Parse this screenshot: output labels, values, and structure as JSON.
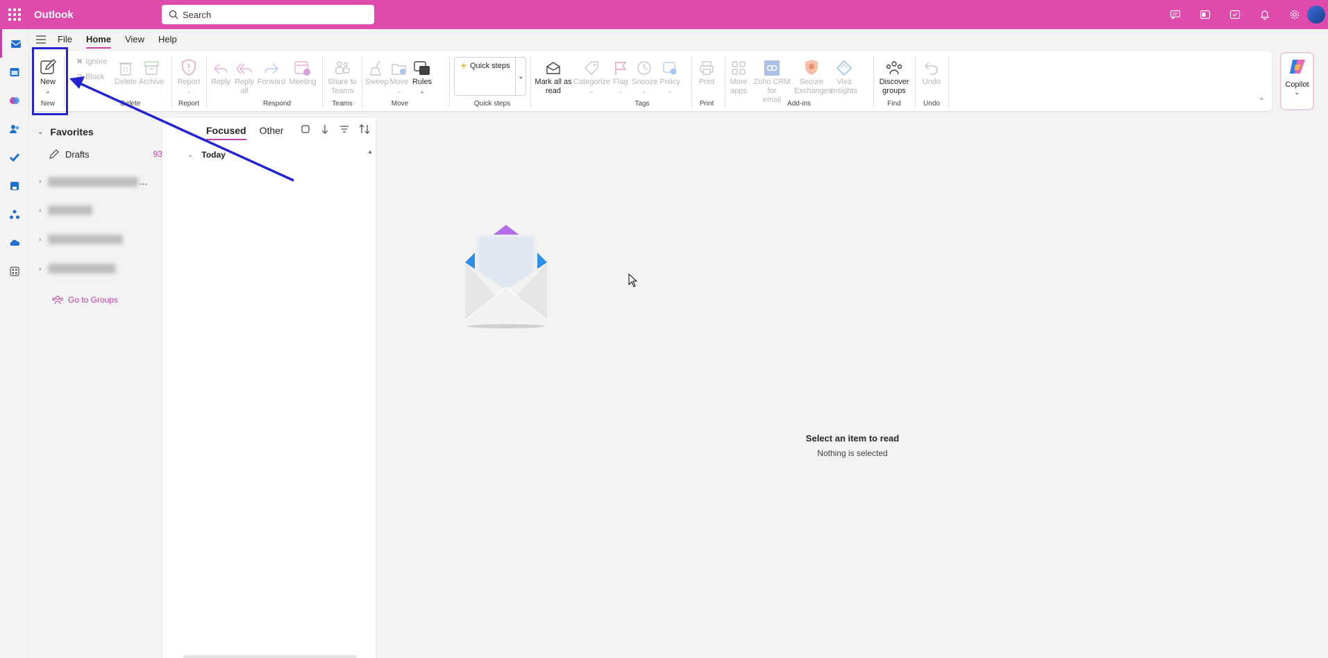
{
  "app": {
    "title": "Outlook",
    "accent": "#df4aad"
  },
  "search": {
    "placeholder": "Search"
  },
  "menu": {
    "tabs": [
      "File",
      "Home",
      "View",
      "Help"
    ],
    "active_tab": "Home"
  },
  "ribbon": {
    "new": {
      "label": "New",
      "group": "New"
    },
    "delete_group": {
      "ignore": "Ignore",
      "block": "Block",
      "delete": "Delete",
      "archive": "Archive",
      "group": "Delete"
    },
    "report": {
      "label": "Report",
      "group": "Report"
    },
    "respond": {
      "reply": "Reply",
      "reply_all_line1": "Reply",
      "reply_all_line2": "all",
      "forward": "Forward",
      "meeting": "Meeting",
      "group": "Respond"
    },
    "teams": {
      "line1": "Share to",
      "line2": "Teams",
      "group": "Teams"
    },
    "move": {
      "sweep": "Sweep",
      "move": "Move",
      "rules": "Rules",
      "group": "Move"
    },
    "quick_steps": {
      "label": "Quick steps",
      "group": "Quick steps"
    },
    "tags": {
      "mark_line1": "Mark all as",
      "mark_line2": "read",
      "categorize": "Categorize",
      "flag": "Flag",
      "snooze": "Snooze",
      "policy": "Policy",
      "group": "Tags"
    },
    "print": {
      "label": "Print",
      "group": "Print"
    },
    "addins": {
      "more_line1": "More",
      "more_line2": "apps",
      "zoho_line1": "Zoho CRM for",
      "zoho_line2": "email",
      "secure_line1": "Secure",
      "secure_line2": "Exchanges",
      "viva_line1": "Viva",
      "viva_line2": "Insights",
      "group": "Add-ins"
    },
    "find": {
      "line1": "Discover",
      "line2": "groups",
      "group": "Find"
    },
    "undo": {
      "label": "Undo",
      "group": "Undo"
    }
  },
  "copilot": {
    "label": "Copilot"
  },
  "folders": {
    "favorites_label": "Favorites",
    "drafts_label": "Drafts",
    "drafts_count": "93",
    "truncated_suffix": "...",
    "go_to_groups": "Go to Groups"
  },
  "mail_list": {
    "tabs": [
      "Focused",
      "Other"
    ],
    "active": "Focused",
    "group_today": "Today"
  },
  "reading_pane": {
    "title": "Select an item to read",
    "subtitle": "Nothing is selected"
  },
  "annotation": {
    "color": "#2323d0"
  }
}
